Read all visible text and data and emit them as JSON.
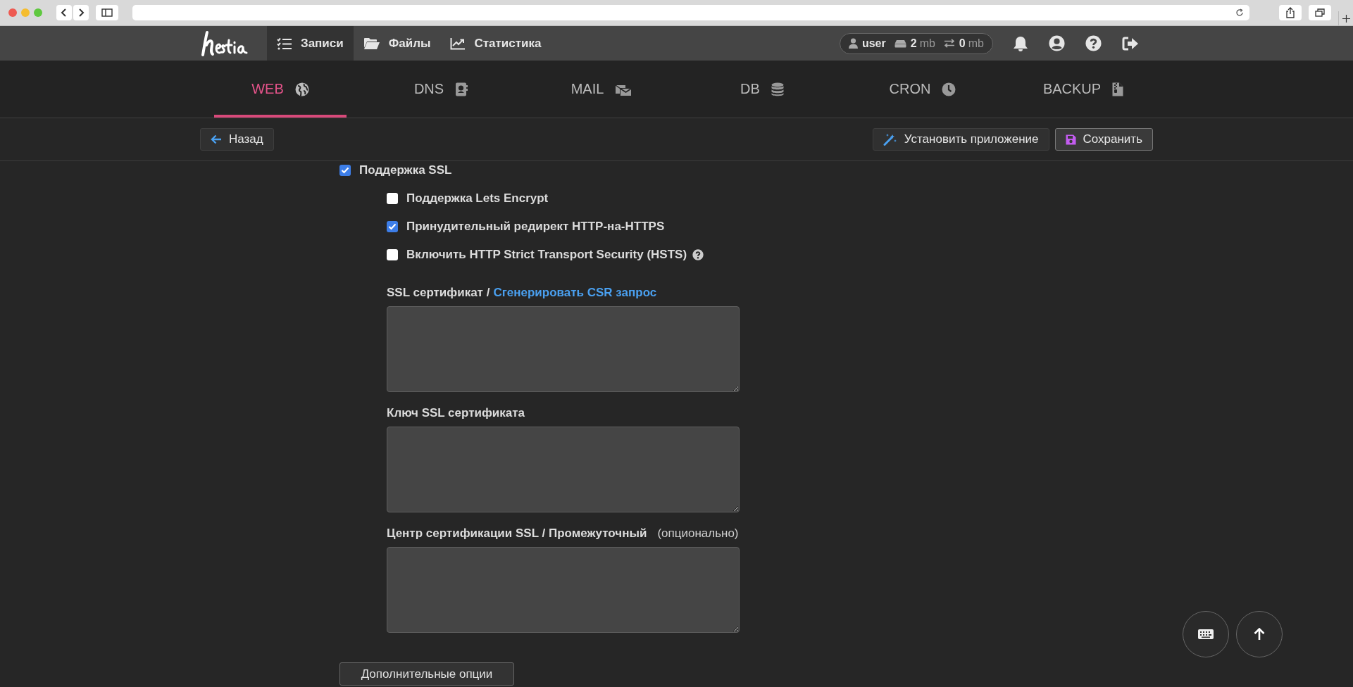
{
  "top_nav": {
    "items": [
      {
        "label": "Записи",
        "selected": true
      },
      {
        "label": "Файлы",
        "selected": false
      },
      {
        "label": "Статистика",
        "selected": false
      }
    ],
    "user": {
      "name": "user",
      "disk_value": "2",
      "disk_unit": "mb",
      "bandwidth_value": "0",
      "bandwidth_unit": "mb"
    }
  },
  "tabs": [
    {
      "label": "WEB",
      "selected": true
    },
    {
      "label": "DNS",
      "selected": false
    },
    {
      "label": "MAIL",
      "selected": false
    },
    {
      "label": "DB",
      "selected": false
    },
    {
      "label": "CRON",
      "selected": false
    },
    {
      "label": "BACKUP",
      "selected": false
    }
  ],
  "toolbar": {
    "back": "Назад",
    "buttons": [
      {
        "label": "Установить приложение"
      },
      {
        "label": "Сохранить"
      }
    ]
  },
  "form": {
    "ssl": {
      "label": "Поддержка SSL",
      "checked": true
    },
    "options": [
      {
        "label": "Поддержка Lets Encrypt",
        "checked": false,
        "help": false
      },
      {
        "label": "Принудительный редирект HTTP-на-HTTPS",
        "checked": true,
        "help": false
      },
      {
        "label": "Включить HTTP Strict Transport Security (HSTS)",
        "checked": false,
        "help": true
      }
    ],
    "fields": [
      {
        "label": "SSL сертификат /",
        "link": "Сгенерировать CSR запрос"
      },
      {
        "label": "Ключ SSL сертификата"
      },
      {
        "label": "Центр сертификации SSL / Промежуточный",
        "hint": "(опционально)"
      }
    ],
    "more_button": "Дополнительные опции"
  }
}
